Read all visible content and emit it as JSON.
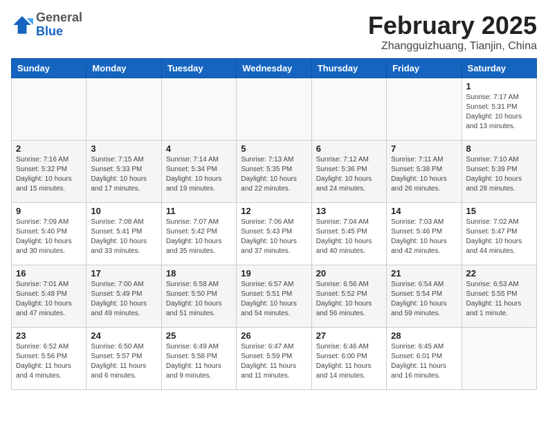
{
  "header": {
    "logo_general": "General",
    "logo_blue": "Blue",
    "title": "February 2025",
    "subtitle": "Zhangguizhuang, Tianjin, China"
  },
  "weekdays": [
    "Sunday",
    "Monday",
    "Tuesday",
    "Wednesday",
    "Thursday",
    "Friday",
    "Saturday"
  ],
  "weeks": [
    [
      {
        "day": "",
        "info": ""
      },
      {
        "day": "",
        "info": ""
      },
      {
        "day": "",
        "info": ""
      },
      {
        "day": "",
        "info": ""
      },
      {
        "day": "",
        "info": ""
      },
      {
        "day": "",
        "info": ""
      },
      {
        "day": "1",
        "info": "Sunrise: 7:17 AM\nSunset: 5:31 PM\nDaylight: 10 hours and 13 minutes."
      }
    ],
    [
      {
        "day": "2",
        "info": "Sunrise: 7:16 AM\nSunset: 5:32 PM\nDaylight: 10 hours and 15 minutes."
      },
      {
        "day": "3",
        "info": "Sunrise: 7:15 AM\nSunset: 5:33 PM\nDaylight: 10 hours and 17 minutes."
      },
      {
        "day": "4",
        "info": "Sunrise: 7:14 AM\nSunset: 5:34 PM\nDaylight: 10 hours and 19 minutes."
      },
      {
        "day": "5",
        "info": "Sunrise: 7:13 AM\nSunset: 5:35 PM\nDaylight: 10 hours and 22 minutes."
      },
      {
        "day": "6",
        "info": "Sunrise: 7:12 AM\nSunset: 5:36 PM\nDaylight: 10 hours and 24 minutes."
      },
      {
        "day": "7",
        "info": "Sunrise: 7:11 AM\nSunset: 5:38 PM\nDaylight: 10 hours and 26 minutes."
      },
      {
        "day": "8",
        "info": "Sunrise: 7:10 AM\nSunset: 5:39 PM\nDaylight: 10 hours and 28 minutes."
      }
    ],
    [
      {
        "day": "9",
        "info": "Sunrise: 7:09 AM\nSunset: 5:40 PM\nDaylight: 10 hours and 30 minutes."
      },
      {
        "day": "10",
        "info": "Sunrise: 7:08 AM\nSunset: 5:41 PM\nDaylight: 10 hours and 33 minutes."
      },
      {
        "day": "11",
        "info": "Sunrise: 7:07 AM\nSunset: 5:42 PM\nDaylight: 10 hours and 35 minutes."
      },
      {
        "day": "12",
        "info": "Sunrise: 7:06 AM\nSunset: 5:43 PM\nDaylight: 10 hours and 37 minutes."
      },
      {
        "day": "13",
        "info": "Sunrise: 7:04 AM\nSunset: 5:45 PM\nDaylight: 10 hours and 40 minutes."
      },
      {
        "day": "14",
        "info": "Sunrise: 7:03 AM\nSunset: 5:46 PM\nDaylight: 10 hours and 42 minutes."
      },
      {
        "day": "15",
        "info": "Sunrise: 7:02 AM\nSunset: 5:47 PM\nDaylight: 10 hours and 44 minutes."
      }
    ],
    [
      {
        "day": "16",
        "info": "Sunrise: 7:01 AM\nSunset: 5:48 PM\nDaylight: 10 hours and 47 minutes."
      },
      {
        "day": "17",
        "info": "Sunrise: 7:00 AM\nSunset: 5:49 PM\nDaylight: 10 hours and 49 minutes."
      },
      {
        "day": "18",
        "info": "Sunrise: 6:58 AM\nSunset: 5:50 PM\nDaylight: 10 hours and 51 minutes."
      },
      {
        "day": "19",
        "info": "Sunrise: 6:57 AM\nSunset: 5:51 PM\nDaylight: 10 hours and 54 minutes."
      },
      {
        "day": "20",
        "info": "Sunrise: 6:56 AM\nSunset: 5:52 PM\nDaylight: 10 hours and 56 minutes."
      },
      {
        "day": "21",
        "info": "Sunrise: 6:54 AM\nSunset: 5:54 PM\nDaylight: 10 hours and 59 minutes."
      },
      {
        "day": "22",
        "info": "Sunrise: 6:53 AM\nSunset: 5:55 PM\nDaylight: 11 hours and 1 minute."
      }
    ],
    [
      {
        "day": "23",
        "info": "Sunrise: 6:52 AM\nSunset: 5:56 PM\nDaylight: 11 hours and 4 minutes."
      },
      {
        "day": "24",
        "info": "Sunrise: 6:50 AM\nSunset: 5:57 PM\nDaylight: 11 hours and 6 minutes."
      },
      {
        "day": "25",
        "info": "Sunrise: 6:49 AM\nSunset: 5:58 PM\nDaylight: 11 hours and 9 minutes."
      },
      {
        "day": "26",
        "info": "Sunrise: 6:47 AM\nSunset: 5:59 PM\nDaylight: 11 hours and 11 minutes."
      },
      {
        "day": "27",
        "info": "Sunrise: 6:46 AM\nSunset: 6:00 PM\nDaylight: 11 hours and 14 minutes."
      },
      {
        "day": "28",
        "info": "Sunrise: 6:45 AM\nSunset: 6:01 PM\nDaylight: 11 hours and 16 minutes."
      },
      {
        "day": "",
        "info": ""
      }
    ]
  ]
}
